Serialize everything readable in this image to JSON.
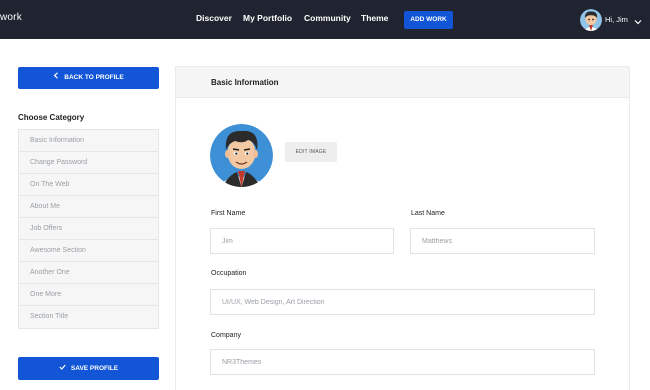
{
  "header": {
    "brand": "work",
    "nav": [
      "Discover",
      "My Portfolio",
      "Community",
      "Theme"
    ],
    "add_work": "ADD WORK",
    "greeting": "Hi, Jim"
  },
  "sidebar": {
    "back_label": "BACK TO PROFILE",
    "category_title": "Choose Category",
    "categories": [
      "Basic Information",
      "Change Password",
      "On The Web",
      "About Me",
      "Job Offers",
      "Awesome Section",
      "Another One",
      "One More",
      "Section Title"
    ],
    "save_label": "SAVE PROFILE"
  },
  "form": {
    "section_title": "Basic Information",
    "edit_image": "EDIT IMAGE",
    "first_name": {
      "label": "First Name",
      "placeholder": "Jim"
    },
    "last_name": {
      "label": "Last Name",
      "placeholder": "Matthews"
    },
    "occupation": {
      "label": "Occupation",
      "placeholder": "UI/UX, Web Design, Art Direction"
    },
    "company": {
      "label": "Company",
      "placeholder": "NR3Themes"
    }
  },
  "icons": {
    "back": "chevron-left-icon",
    "save": "check-icon",
    "user_menu": "chevron-down-icon"
  },
  "colors": {
    "topbar": "#1f2430",
    "accent": "#1255d6",
    "panel_header": "#f5f5f5",
    "muted_text": "#9aa0a6"
  }
}
